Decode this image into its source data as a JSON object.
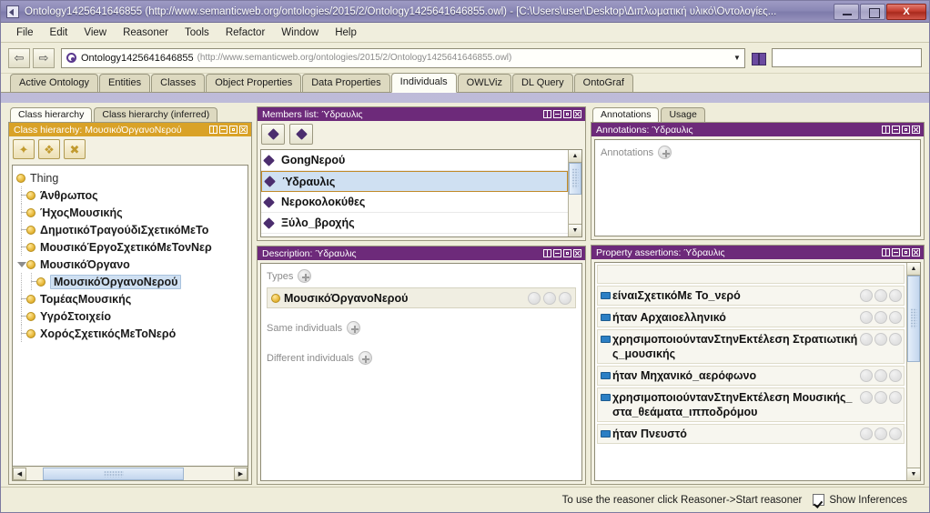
{
  "window": {
    "title": "Ontology1425641646855 (http://www.semanticweb.org/ontologies/2015/2/Ontology1425641646855.owl) - [C:\\Users\\user\\Desktop\\Διπλωματική υλικό\\Οντολογίες...",
    "app_icon": "protege-icon",
    "minimize_label": "",
    "maximize_label": "",
    "close_label": "X"
  },
  "menubar": {
    "items": [
      {
        "label": "File"
      },
      {
        "label": "Edit"
      },
      {
        "label": "View"
      },
      {
        "label": "Reasoner"
      },
      {
        "label": "Tools"
      },
      {
        "label": "Refactor"
      },
      {
        "label": "Window"
      },
      {
        "label": "Help"
      }
    ]
  },
  "toolbar": {
    "back_label": "⇦",
    "forward_label": "⇨",
    "ontology_name": "Ontology1425641646855",
    "ontology_iri": "(http://www.semanticweb.org/ontologies/2015/2/Ontology1425641646855.owl)",
    "combo_arrow": "▼",
    "search_icon": "binoculars-icon",
    "search_value": "",
    "search_placeholder": ""
  },
  "tabs": [
    {
      "label": "Active Ontology",
      "active": false
    },
    {
      "label": "Entities",
      "active": false
    },
    {
      "label": "Classes",
      "active": false
    },
    {
      "label": "Object Properties",
      "active": false
    },
    {
      "label": "Data Properties",
      "active": false
    },
    {
      "label": "Individuals",
      "active": true
    },
    {
      "label": "OWLViz",
      "active": false
    },
    {
      "label": "DL Query",
      "active": false
    },
    {
      "label": "OntoGraf",
      "active": false
    }
  ],
  "class_hierarchy": {
    "tabs": [
      {
        "label": "Class hierarchy",
        "active": true
      },
      {
        "label": "Class hierarchy (inferred)",
        "active": false
      }
    ],
    "header": "Class hierarchy: ΜουσικόΌργανοΝερού",
    "toolbar": [
      {
        "name": "add-subclass-button",
        "glyph": "✦"
      },
      {
        "name": "add-sibling-class-button",
        "glyph": "❖"
      },
      {
        "name": "delete-class-button",
        "glyph": "✖"
      }
    ],
    "tree": [
      {
        "label": "Thing",
        "depth": 0,
        "expanded": true,
        "selected": false,
        "root": true
      },
      {
        "label": "Άνθρωπος",
        "depth": 1,
        "expanded": false,
        "selected": false
      },
      {
        "label": "ΉχοςΜουσικής",
        "depth": 1,
        "expanded": false,
        "selected": false
      },
      {
        "label": "ΔημοτικόΤραγούδιΣχετικόΜεΤο",
        "depth": 1,
        "expanded": false,
        "selected": false
      },
      {
        "label": "ΜουσικόΈργοΣχετικόΜεΤονΝερ",
        "depth": 1,
        "expanded": false,
        "selected": false
      },
      {
        "label": "ΜουσικόΌργανο",
        "depth": 1,
        "expanded": true,
        "selected": false
      },
      {
        "label": "ΜουσικόΌργανοΝερού",
        "depth": 2,
        "expanded": false,
        "selected": true
      },
      {
        "label": "ΤομέαςΜουσικής",
        "depth": 1,
        "expanded": false,
        "selected": false
      },
      {
        "label": "ΥγρόΣτοιχείο",
        "depth": 1,
        "expanded": false,
        "selected": false
      },
      {
        "label": "ΧορόςΣχετικόςΜεΤοΝερό",
        "depth": 1,
        "expanded": false,
        "selected": false
      }
    ]
  },
  "members_list": {
    "header": "Members list: Ύδραυλις",
    "toolbar": [
      {
        "name": "add-individual-button"
      },
      {
        "name": "delete-individual-button"
      }
    ],
    "items": [
      {
        "label": "GongΝερού",
        "selected": false
      },
      {
        "label": "Ύδραυλις",
        "selected": true
      },
      {
        "label": "Νεροκολοκύθες",
        "selected": false
      },
      {
        "label": "Ξύλο_βροχής",
        "selected": false
      }
    ]
  },
  "description": {
    "header": "Description: Ύδραυλις",
    "sections": [
      {
        "label": "Types"
      },
      {
        "label": "Same individuals"
      },
      {
        "label": "Different individuals"
      }
    ],
    "types": [
      {
        "label": "ΜουσικόΌργανοΝερού"
      }
    ]
  },
  "annotations": {
    "tabs": [
      {
        "label": "Annotations",
        "active": true
      },
      {
        "label": "Usage",
        "active": false
      }
    ],
    "header": "Annotations: Ύδραυλις",
    "section_label": "Annotations",
    "items": []
  },
  "property_assertions": {
    "header": "Property assertions: Ύδραυλις",
    "rows": [
      {
        "text": "είναιΣχετικόΜε  Το_νερό"
      },
      {
        "text": "ήταν  Αρχαιοελληνικό"
      },
      {
        "text": "χρησιμοποιούντανΣτηνΕκτέλεση Στρατιωτικής_μουσικής"
      },
      {
        "text": "ήταν  Μηχανικό_αερόφωνο"
      },
      {
        "text": "χρησιμοποιούντανΣτηνΕκτέλεση Μουσικής_στα_θεάματα_ιπποδρόμου"
      },
      {
        "text": "ήταν  Πνευστό"
      }
    ]
  },
  "statusbar": {
    "message": "To use the reasoner click Reasoner->Start reasoner",
    "show_inferences_label": "Show Inferences",
    "show_inferences_checked": true
  },
  "colors": {
    "panel_header_active": "#6d2a7a",
    "panel_header_inactive": "#d9a227",
    "selection": "#cfe0f2",
    "class_bullet": "#e8b93c",
    "individual_diamond": "#4b2d6e",
    "property_icon": "#2b7fc4"
  }
}
